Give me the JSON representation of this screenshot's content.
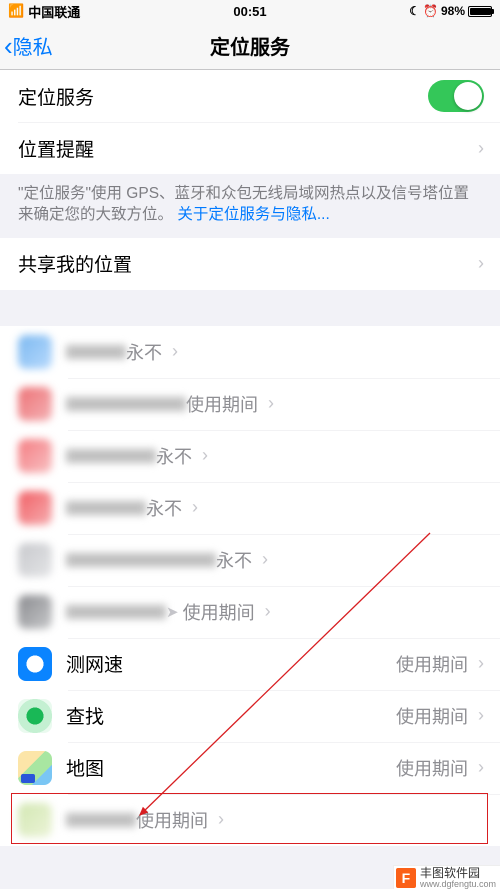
{
  "statusbar": {
    "carrier": "中国联通",
    "time": "00:51",
    "battery": "98%"
  },
  "nav": {
    "back": "隐私",
    "title": "定位服务"
  },
  "rows": {
    "locServiceLabel": "定位服务",
    "locAlertLabel": "位置提醒",
    "shareLabel": "共享我的位置"
  },
  "info": {
    "text": "\"定位服务\"使用 GPS、蓝牙和众包无线局域网热点以及信号塔位置来确定您的大致方位。",
    "link": "关于定位服务与隐私..."
  },
  "values": {
    "never": "永不",
    "whileUsing": "使用期间"
  },
  "apps": {
    "speedtest": "测网速",
    "findmy": "查找",
    "maps": "地图"
  },
  "watermark": {
    "name": "丰图软件园",
    "url": "www.dgfengtu.com"
  }
}
